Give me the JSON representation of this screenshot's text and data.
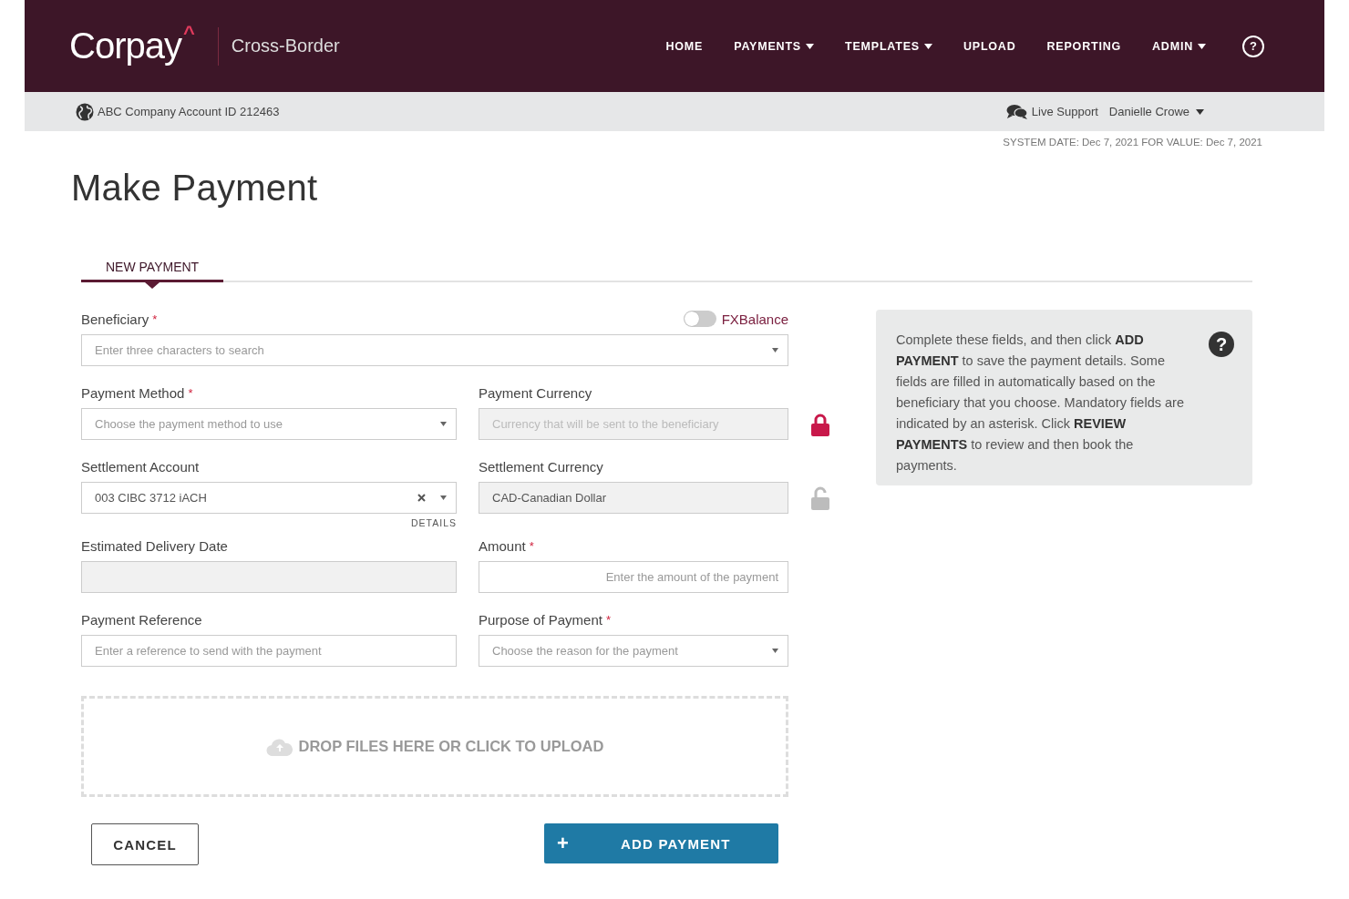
{
  "header": {
    "logo": "Corpay",
    "logo_mark": "^",
    "product": "Cross-Border",
    "help": "?",
    "nav": [
      {
        "label": "HOME",
        "dropdown": false
      },
      {
        "label": "PAYMENTS",
        "dropdown": true
      },
      {
        "label": "TEMPLATES",
        "dropdown": true
      },
      {
        "label": "UPLOAD",
        "dropdown": false
      },
      {
        "label": "REPORTING",
        "dropdown": false
      },
      {
        "label": "ADMIN",
        "dropdown": true
      }
    ]
  },
  "account_bar": {
    "account": "ABC Company Account ID 212463",
    "support": "Live Support",
    "user": "Danielle Crowe"
  },
  "system_date": "SYSTEM DATE: Dec 7, 2021 FOR VALUE: Dec 7, 2021",
  "title": "Make Payment",
  "tabs": [
    {
      "label": "NEW PAYMENT",
      "selected": true
    }
  ],
  "toggle": {
    "label": "FXBalance",
    "on": false
  },
  "required_mark": "*",
  "rows": [
    [
      {
        "label": "Beneficiary",
        "required": true,
        "kind": "select",
        "placeholder": "Enter three characters to search"
      }
    ],
    [
      {
        "label": "Payment Method",
        "required": true,
        "kind": "select",
        "placeholder": "Choose the payment method to use"
      },
      {
        "label": "Payment Currency",
        "required": false,
        "kind": "readonly",
        "placeholder": "Currency that will be sent to the beneficiary",
        "locked": true
      }
    ],
    [
      {
        "label": "Settlement Account",
        "required": false,
        "kind": "select",
        "value": "003 CIBC 3712 iACH",
        "clearable": true,
        "link": "DETAILS"
      },
      {
        "label": "Settlement Currency",
        "required": false,
        "kind": "readonly",
        "value": "CAD-Canadian Dollar",
        "locked": false
      }
    ],
    [
      {
        "label": "Estimated Delivery Date",
        "required": false,
        "kind": "readonly"
      },
      {
        "label": "Amount",
        "required": true,
        "kind": "amount",
        "placeholder": "Enter the amount of the payment"
      }
    ],
    [
      {
        "label": "Payment Reference",
        "required": false,
        "kind": "text",
        "placeholder": "Enter a reference to send with the payment"
      },
      {
        "label": "Purpose of Payment",
        "required": true,
        "kind": "select",
        "placeholder": "Choose the reason for the payment"
      }
    ]
  ],
  "upload": {
    "label": "DROP FILES HERE OR CLICK TO UPLOAD"
  },
  "buttons": [
    {
      "label": "CANCEL",
      "kind": "secondary"
    },
    {
      "label": "ADD PAYMENT",
      "kind": "primary",
      "icon": "+"
    }
  ],
  "help": {
    "text": "Complete these fields, and then click **ADD PAYMENT** to save the payment details. Some fields are filled in automatically based on the beneficiary that you choose. Mandatory fields are indicated by an asterisk. Click **REVIEW PAYMENTS** to review and then book the payments.",
    "icon": "?"
  }
}
